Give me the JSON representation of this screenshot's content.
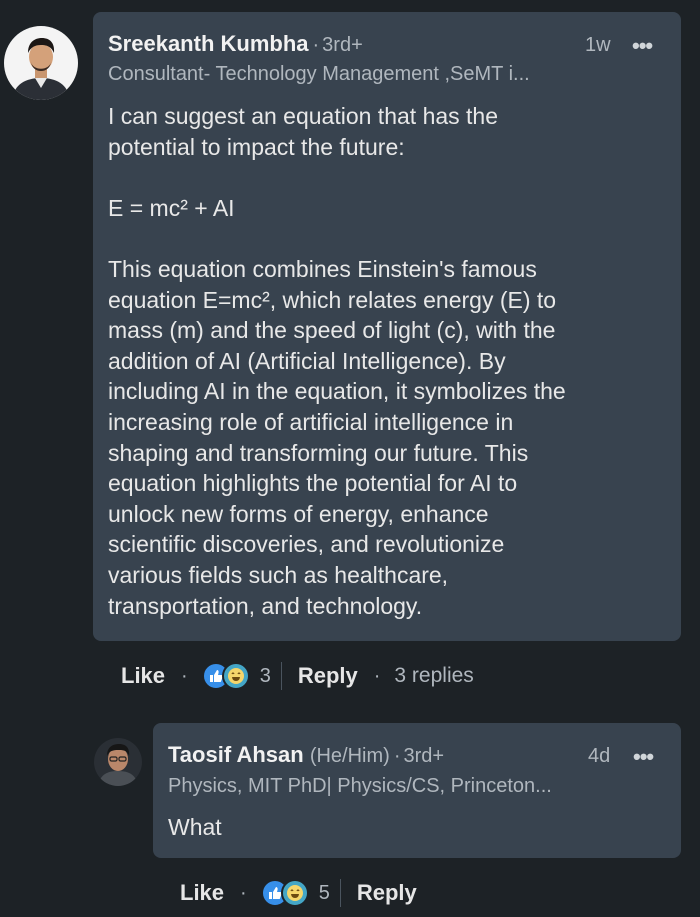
{
  "comment": {
    "author": "Sreekanth Kumbha",
    "separator": "·",
    "degree": "3rd+",
    "time": "1w",
    "more": "•••",
    "headline": "Consultant- Technology Management ,SeMT i...",
    "text": "I can suggest an equation that has the\npotential to impact the future:\n\nE = mc² + AI\n\nThis equation combines Einstein's famous\nequation E=mc², which relates energy (E) to\nmass (m) and the speed of light (c), with the\naddition of AI (Artificial Intelligence). By\nincluding AI in the equation, it symbolizes the\nincreasing role of artificial intelligence in\nshaping and transforming our future. This\nequation highlights the potential for AI to\nunlock new forms of energy, enhance\nscientific discoveries, and revolutionize\nvarious fields such as healthcare,\ntransportation, and technology.",
    "actions": {
      "like": "Like",
      "dot": "·",
      "reaction_count": "3",
      "reply": "Reply",
      "replies": "3 replies"
    }
  },
  "reply": {
    "author": "Taosif Ahsan",
    "pronouns": "(He/Him)",
    "separator": "·",
    "degree": "3rd+",
    "time": "4d",
    "more": "•••",
    "headline": "Physics, MIT PhD| Physics/CS, Princeton...",
    "text": "What",
    "actions": {
      "like": "Like",
      "dot": "·",
      "reaction_count": "5",
      "reply": "Reply"
    }
  },
  "colors": {
    "background": "#1d2226",
    "bubble": "#38434f",
    "like_reaction": "#378fe9",
    "funny_reaction": "#44a6c6"
  },
  "icons": {
    "like_reaction": "thumbs-up-icon",
    "funny_reaction": "laughing-face-icon",
    "more": "more-options-icon"
  }
}
